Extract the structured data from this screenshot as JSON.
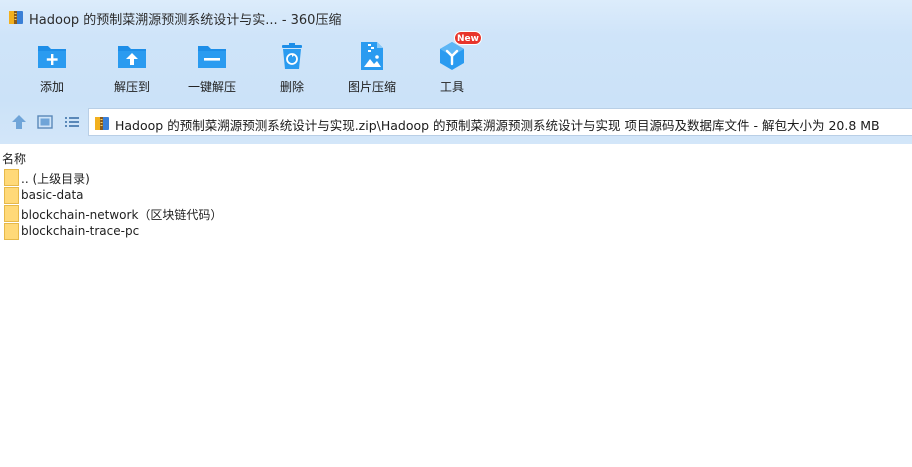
{
  "window": {
    "title": "Hadoop 的预制菜溯源预测系统设计与实... - 360压缩"
  },
  "toolbar": {
    "buttons": [
      {
        "id": "add",
        "label": "添加",
        "icon": "add-folder-icon"
      },
      {
        "id": "extract",
        "label": "解压到",
        "icon": "extract-folder-icon"
      },
      {
        "id": "oneclick",
        "label": "一键解压",
        "icon": "one-click-extract-icon"
      },
      {
        "id": "delete",
        "label": "删除",
        "icon": "recycle-bin-icon"
      },
      {
        "id": "image",
        "label": "图片压缩",
        "icon": "image-compress-icon"
      },
      {
        "id": "tools",
        "label": "工具",
        "icon": "tools-icon"
      }
    ],
    "new_badge": "New"
  },
  "nav": {
    "address": "Hadoop 的预制菜溯源预测系统设计与实现.zip\\Hadoop 的预制菜溯源预测系统设计与实现 项目源码及数据库文件 - 解包大小为 20.8 MB"
  },
  "filelist": {
    "column_name": "名称",
    "items": [
      {
        "name": ".. (上级目录)"
      },
      {
        "name": "basic-data"
      },
      {
        "name": "blockchain-network（区块链代码）"
      },
      {
        "name": "blockchain-trace-pc"
      }
    ]
  },
  "colors": {
    "accent_blue": "#1d8ee8",
    "folder_yellow": "#ffd978",
    "badge_red": "#e8352b"
  }
}
